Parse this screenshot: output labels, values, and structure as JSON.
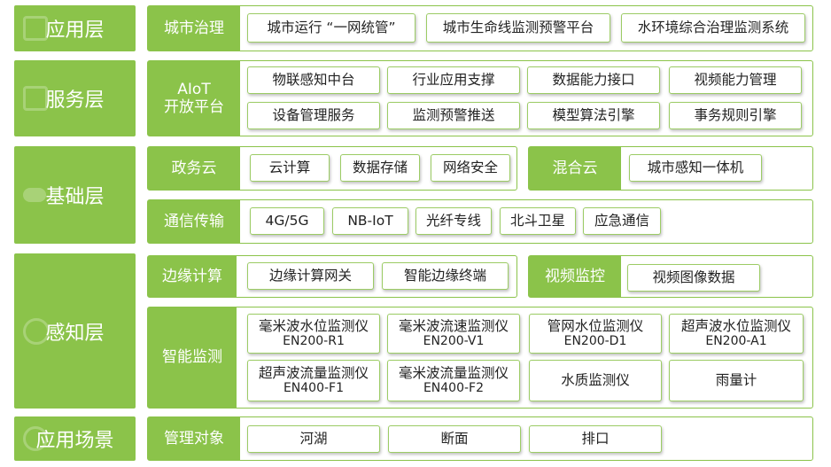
{
  "layers": {
    "application": "应用层",
    "service": "服务层",
    "foundation": "基础层",
    "perception": "感知层",
    "scenario": "应用场景"
  },
  "city_governance": {
    "label": "城市治理",
    "items": [
      "城市运行 “一网统管”",
      "城市生命线监测预警平台",
      "水环境综合治理监测系统"
    ]
  },
  "aiot": {
    "label_line1": "AIoT",
    "label_line2": "开放平台",
    "items": [
      "物联感知中台",
      "行业应用支撑",
      "数据能力接口",
      "视频能力管理",
      "设备管理服务",
      "监测预警推送",
      "模型算法引擎",
      "事务规则引擎"
    ]
  },
  "gov_cloud": {
    "label": "政务云",
    "items": [
      "云计算",
      "数据存储",
      "网络安全"
    ]
  },
  "hybrid_cloud": {
    "label": "混合云",
    "items": [
      "城市感知一体机"
    ]
  },
  "communication": {
    "label": "通信传输",
    "items": [
      "4G/5G",
      "NB-IoT",
      "光纤专线",
      "北斗卫星",
      "应急通信"
    ]
  },
  "edge": {
    "label": "边缘计算",
    "items": [
      "边缘计算网关",
      "智能边缘终端"
    ]
  },
  "video": {
    "label": "视频监控",
    "items": [
      "视频图像数据"
    ]
  },
  "smart_monitoring": {
    "label": "智能监测",
    "devices": [
      {
        "name": "毫米波水位监测仪",
        "model": "EN200-R1"
      },
      {
        "name": "毫米波流速监测仪",
        "model": "EN200-V1"
      },
      {
        "name": "管网水位监测仪",
        "model": "EN200-D1"
      },
      {
        "name": "超声波水位监测仪",
        "model": "EN200-A1"
      },
      {
        "name": "超声波流量监测仪",
        "model": "EN400-F1"
      },
      {
        "name": "毫米波流量监测仪",
        "model": "EN400-F2"
      },
      {
        "name": "水质监测仪",
        "model": ""
      },
      {
        "name": "雨量计",
        "model": ""
      }
    ]
  },
  "management": {
    "label": "管理对象",
    "items": [
      "河湖",
      "断面",
      "排口"
    ]
  },
  "colors": {
    "green": "#8bc34a",
    "border": "#9ccc65"
  }
}
